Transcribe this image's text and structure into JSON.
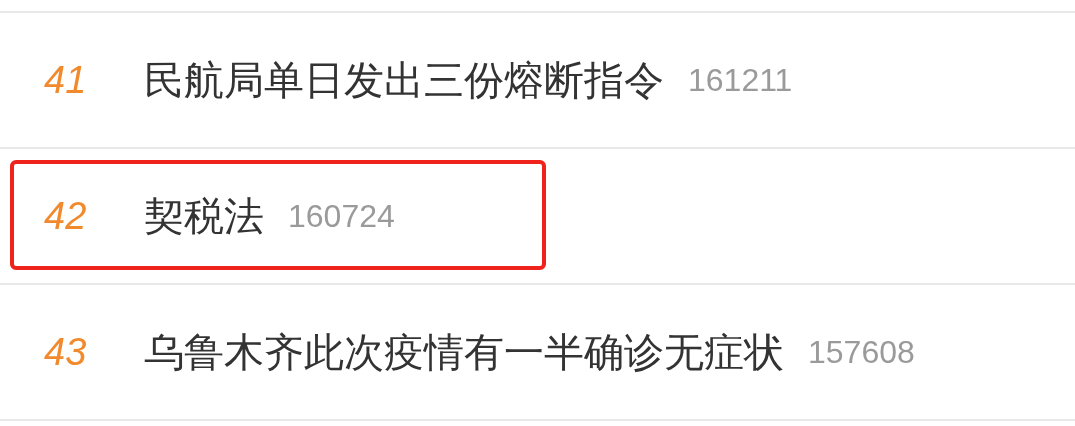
{
  "rows": [
    {
      "rank": "41",
      "title": "民航局单日发出三份熔断指令",
      "count": "161211",
      "highlighted": false
    },
    {
      "rank": "42",
      "title": "契税法",
      "count": "160724",
      "highlighted": true
    },
    {
      "rank": "43",
      "title": "乌鲁木齐此次疫情有一半确诊无症状",
      "count": "157608",
      "highlighted": false
    }
  ]
}
